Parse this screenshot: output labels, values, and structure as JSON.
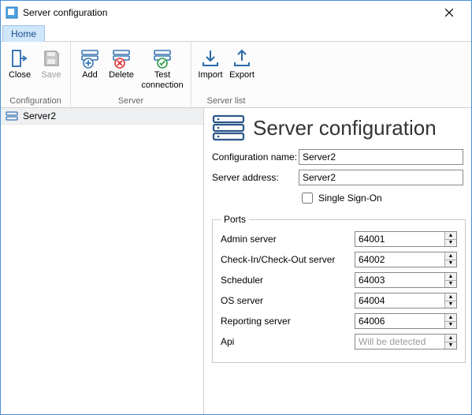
{
  "window": {
    "title": "Server configuration"
  },
  "tabs": {
    "home": "Home"
  },
  "ribbon": {
    "close": "Close",
    "save": "Save",
    "add": "Add",
    "delete": "Delete",
    "test": "Test connection",
    "import": "Import",
    "export": "Export",
    "group_config": "Configuration",
    "group_server": "Server",
    "group_list": "Server list"
  },
  "sidebar": {
    "items": [
      {
        "label": "Server2"
      }
    ]
  },
  "main": {
    "title": "Server configuration",
    "config_name_label": "Configuration name:",
    "config_name_value": "Server2",
    "server_address_label": "Server address:",
    "server_address_value": "Server2",
    "sso_label": "Single Sign-On",
    "sso_checked": false,
    "ports_legend": "Ports",
    "ports": {
      "admin_label": "Admin server",
      "admin_value": "64001",
      "cico_label": "Check-In/Check-Out server",
      "cico_value": "64002",
      "sched_label": "Scheduler",
      "sched_value": "64003",
      "os_label": "OS server",
      "os_value": "64004",
      "report_label": "Reporting server",
      "report_value": "64006",
      "api_label": "Api",
      "api_placeholder": "Will be detected"
    }
  }
}
